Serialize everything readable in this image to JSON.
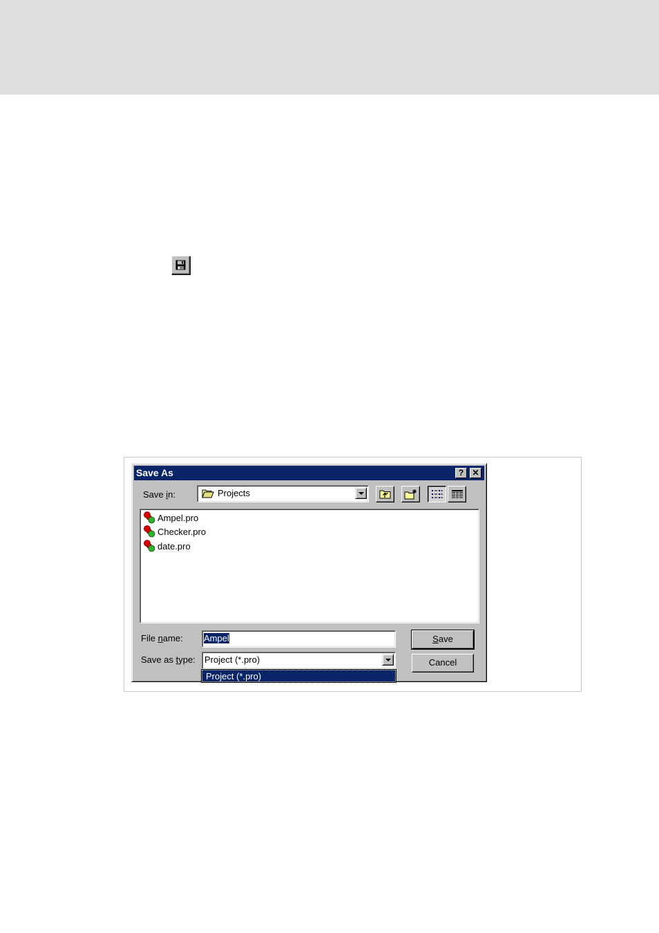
{
  "dialog": {
    "title": "Save As",
    "help_button": "?",
    "close_button": "✕",
    "save_in_label_pre": "Save ",
    "save_in_label_key": "i",
    "save_in_label_post": "n:",
    "save_in_value": "Projects",
    "files": [
      {
        "name": "Ampel.pro",
        "icon": "project-file-icon"
      },
      {
        "name": "Checker.pro",
        "icon": "project-file-icon"
      },
      {
        "name": "date.pro",
        "icon": "project-file-icon"
      }
    ],
    "file_name_label_pre": "File ",
    "file_name_label_key": "n",
    "file_name_label_post": "ame:",
    "file_name_value": "Ampel",
    "save_as_type_label_pre": "Save as ",
    "save_as_type_label_key": "t",
    "save_as_type_label_post": "ype:",
    "save_as_type_value": "Project (*.pro)",
    "dropdown_option": "Project (*.pro)",
    "save_button_key": "S",
    "save_button_rest": "ave",
    "cancel_button": "Cancel"
  },
  "colors": {
    "titlebar": "#0a246a",
    "dialog_face": "#c0c0c0",
    "top_band": "#dedede"
  }
}
